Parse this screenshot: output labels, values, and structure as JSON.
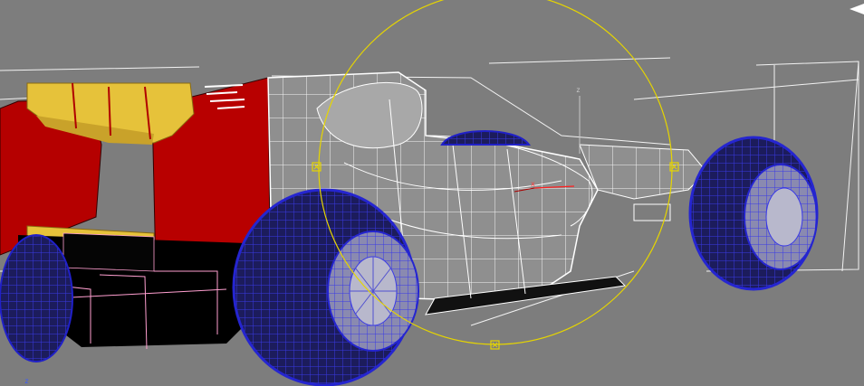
{
  "viewport": {
    "background_color": "#7d7d7d",
    "world_axis_label": "z",
    "gizmo_axis_label": "z",
    "gizmo_x_label": "x"
  },
  "colors": {
    "wireframe_body": "#ffffff",
    "body_shade": "#9a9a9a",
    "tire_wire": "#2020c8",
    "tire_fill": "#15154a",
    "rear_wing_red": "#b00000",
    "wing_yellow": "#e6c23a",
    "selection_circle": "#e6d500",
    "floor_outline": "#ff9fd0",
    "shadow_black": "#000000"
  }
}
